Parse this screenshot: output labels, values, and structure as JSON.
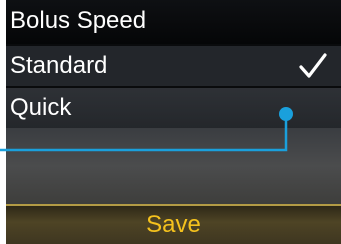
{
  "header": {
    "title": "Bolus Speed"
  },
  "menu": {
    "items": [
      {
        "label": "Standard",
        "selected": true,
        "icon": "checkmark-icon"
      },
      {
        "label": "Quick",
        "selected": false
      }
    ]
  },
  "footer": {
    "save_label": "Save"
  },
  "colors": {
    "callout": "#1aa0dc",
    "save_text": "#f5c21d",
    "footer_border": "#b39b45"
  }
}
